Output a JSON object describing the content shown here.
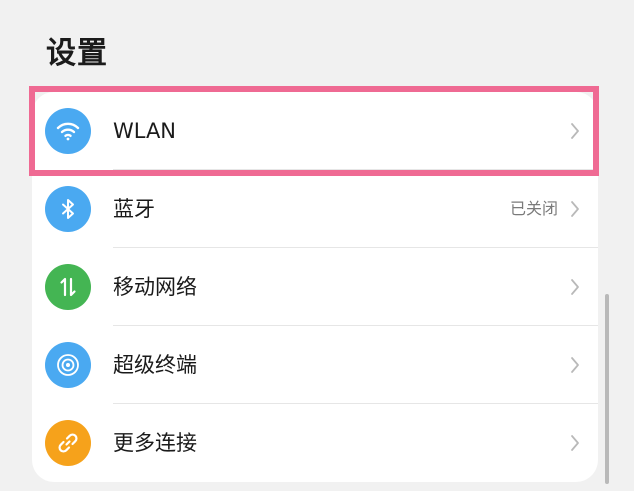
{
  "page": {
    "title": "设置"
  },
  "settings": {
    "items": [
      {
        "label": "WLAN",
        "value": "",
        "icon": "wifi-icon",
        "icon_color": "#4aa9f1"
      },
      {
        "label": "蓝牙",
        "value": "已关闭",
        "icon": "bluetooth-icon",
        "icon_color": "#4aa9f1"
      },
      {
        "label": "移动网络",
        "value": "",
        "icon": "mobile-data-icon",
        "icon_color": "#44b553"
      },
      {
        "label": "超级终端",
        "value": "",
        "icon": "super-device-icon",
        "icon_color": "#4aa9f1"
      },
      {
        "label": "更多连接",
        "value": "",
        "icon": "link-icon",
        "icon_color": "#f6a21b"
      }
    ]
  },
  "colors": {
    "highlight": "#ef6a93",
    "background": "#f1f1f1"
  }
}
